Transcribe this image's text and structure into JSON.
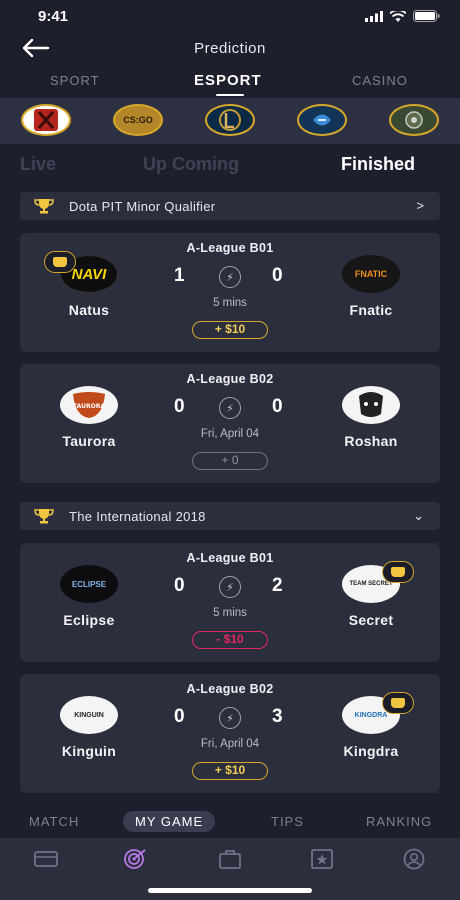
{
  "status_bar": {
    "time": "9:41"
  },
  "header": {
    "title": "Prediction"
  },
  "category_tabs": [
    {
      "label": "SPORT"
    },
    {
      "label": "ESPORT",
      "active": true
    },
    {
      "label": "CASINO"
    }
  ],
  "games": [
    {
      "icon": "dota2-icon",
      "label": ""
    },
    {
      "icon": "csgo-icon",
      "label": "CS:GO"
    },
    {
      "icon": "lol-icon",
      "label": ""
    },
    {
      "icon": "starcraft-icon",
      "label": ""
    },
    {
      "icon": "overwatch-icon",
      "label": ""
    }
  ],
  "sub_tabs": [
    {
      "label": "Live"
    },
    {
      "label": "Up Coming"
    },
    {
      "label": "Finished",
      "active": true
    }
  ],
  "groups": [
    {
      "name": "Dota PIT Minor Qualifier",
      "chevron": ">",
      "matches": [
        {
          "league": "A-League B01",
          "team_left": "Natus",
          "team_right": "Fnatic",
          "logo_left": "NAVI",
          "logo_right": "FNATIC",
          "score_left": "1",
          "score_right": "0",
          "info": "5 mins",
          "bet": "+ $10",
          "bet_type": "win",
          "winner": "left"
        },
        {
          "league": "A-League B02",
          "team_left": "Taurora",
          "team_right": "Roshan",
          "logo_left": "TAURORA",
          "logo_right": "",
          "score_left": "0",
          "score_right": "0",
          "info": "Fri, April 04",
          "bet": "+ 0",
          "bet_type": "neutral",
          "winner": ""
        }
      ]
    },
    {
      "name": "The International 2018",
      "chevron": "⌄",
      "matches": [
        {
          "league": "A-League B01",
          "team_left": "Eclipse",
          "team_right": "Secret",
          "logo_left": "ECLIPSE",
          "logo_right": "TEAM SECRET",
          "score_left": "0",
          "score_right": "2",
          "info": "5 mins",
          "bet": "- $10",
          "bet_type": "loss",
          "winner": "right"
        },
        {
          "league": "A-League B02",
          "team_left": "Kinguin",
          "team_right": "Kingdra",
          "logo_left": "KINGUIN",
          "logo_right": "KINGDRA",
          "score_left": "0",
          "score_right": "3",
          "info": "Fri, April 04",
          "bet": "+ $10",
          "bet_type": "win",
          "winner": "right"
        }
      ]
    }
  ],
  "bottom_tabs": [
    {
      "label": "MATCH"
    },
    {
      "label": "MY GAME",
      "active": true
    },
    {
      "label": "TIPS"
    },
    {
      "label": "RANKING"
    }
  ],
  "tab_bar": [
    {
      "icon": "ticket-icon"
    },
    {
      "icon": "target-icon",
      "active": true
    },
    {
      "icon": "bag-icon"
    },
    {
      "icon": "star-icon"
    },
    {
      "icon": "profile-icon"
    }
  ],
  "colors": {
    "background": "#1d1f2c",
    "card": "#2b2e3d",
    "gold": "#d5a72a",
    "loss": "#e2275e",
    "active_icon": "#b679e6"
  }
}
